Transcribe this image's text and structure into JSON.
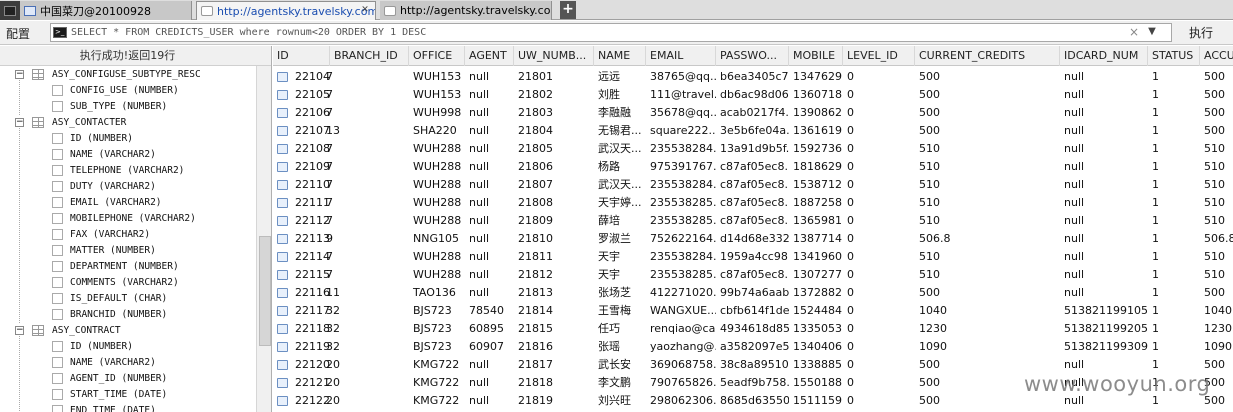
{
  "tabs": [
    {
      "label": "",
      "icon": "terminal-icon"
    },
    {
      "label": "中国菜刀@20100928",
      "icon": "window-icon"
    },
    {
      "label": "http://agentsky.travelsky.com...",
      "icon": "page-icon",
      "active": true
    },
    {
      "label": "http://agentsky.travelsky.com...",
      "icon": "page-icon"
    }
  ],
  "tab_new_label": "+",
  "toolbar": {
    "config_label": "配置",
    "sql": "SELECT * FROM CREDICTS_USER where rownum<20 ORDER BY 1 DESC",
    "clear_glyph": "×",
    "dropdown_glyph": "▼",
    "execute_label": "执行"
  },
  "left_panel": {
    "status": "执行成功!返回19行",
    "tree": [
      {
        "kind": "table",
        "toggle": "−",
        "label": "ASY_CONFIGUSE_SUBTYPE_RESC"
      },
      {
        "kind": "column",
        "label": "CONFIG_USE (NUMBER)"
      },
      {
        "kind": "column",
        "label": "SUB_TYPE (NUMBER)"
      },
      {
        "kind": "table",
        "toggle": "−",
        "label": "ASY_CONTACTER"
      },
      {
        "kind": "column",
        "label": "ID (NUMBER)"
      },
      {
        "kind": "column",
        "label": "NAME (VARCHAR2)"
      },
      {
        "kind": "column",
        "label": "TELEPHONE (VARCHAR2)"
      },
      {
        "kind": "column",
        "label": "DUTY (VARCHAR2)"
      },
      {
        "kind": "column",
        "label": "EMAIL (VARCHAR2)"
      },
      {
        "kind": "column",
        "label": "MOBILEPHONE (VARCHAR2)"
      },
      {
        "kind": "column",
        "label": "FAX (VARCHAR2)"
      },
      {
        "kind": "column",
        "label": "MATTER (NUMBER)"
      },
      {
        "kind": "column",
        "label": "DEPARTMENT (NUMBER)"
      },
      {
        "kind": "column",
        "label": "COMMENTS (VARCHAR2)"
      },
      {
        "kind": "column",
        "label": "IS_DEFAULT (CHAR)"
      },
      {
        "kind": "column",
        "label": "BRANCHID (NUMBER)"
      },
      {
        "kind": "table",
        "toggle": "−",
        "label": "ASY_CONTRACT"
      },
      {
        "kind": "column",
        "label": "ID (NUMBER)"
      },
      {
        "kind": "column",
        "label": "NAME (VARCHAR2)"
      },
      {
        "kind": "column",
        "label": "AGENT_ID (NUMBER)"
      },
      {
        "kind": "column",
        "label": "START_TIME (DATE)"
      },
      {
        "kind": "column",
        "label": "END_TIME (DATE)"
      }
    ]
  },
  "grid": {
    "columns": [
      "ID",
      "BRANCH_ID",
      "OFFICE",
      "AGENT",
      "UW_NUMB...",
      "NAME",
      "EMAIL",
      "PASSWO...",
      "MOBILE",
      "LEVEL_ID",
      "CURRENT_CREDITS",
      "IDCARD_NUM",
      "STATUS",
      "ACCU"
    ],
    "rows": [
      [
        "22104",
        "7",
        "WUH153",
        "null",
        "21801",
        "远远",
        "38765@qq....",
        "b6ea3405c7...",
        "1347629...",
        "0",
        "500",
        "null",
        "1",
        "500"
      ],
      [
        "22105",
        "7",
        "WUH153",
        "null",
        "21802",
        "刘胜",
        "111@travel...",
        "db6ac98d06...",
        "1360718...",
        "0",
        "500",
        "null",
        "1",
        "500"
      ],
      [
        "22106",
        "7",
        "WUH998",
        "null",
        "21803",
        "李融融",
        "35678@qq....",
        "acab0217f4...",
        "1390862...",
        "0",
        "500",
        "null",
        "1",
        "500"
      ],
      [
        "22107",
        "13",
        "SHA220",
        "null",
        "21804",
        "无锡君...",
        "square222...",
        "3e5b6fe04a...",
        "1361619...",
        "0",
        "500",
        "null",
        "1",
        "500"
      ],
      [
        "22108",
        "7",
        "WUH288",
        "null",
        "21805",
        "武汉天...",
        "235538284...",
        "13a91d9b5f...",
        "1592736...",
        "0",
        "510",
        "null",
        "1",
        "510"
      ],
      [
        "22109",
        "7",
        "WUH288",
        "null",
        "21806",
        "杨路",
        "975391767...",
        "c87af05ec8...",
        "1818629...",
        "0",
        "510",
        "null",
        "1",
        "510"
      ],
      [
        "22110",
        "7",
        "WUH288",
        "null",
        "21807",
        "武汉天...",
        "235538284...",
        "c87af05ec8...",
        "1538712...",
        "0",
        "510",
        "null",
        "1",
        "510"
      ],
      [
        "22111",
        "7",
        "WUH288",
        "null",
        "21808",
        "天宇婷...",
        "235538285...",
        "c87af05ec8...",
        "1887258...",
        "0",
        "510",
        "null",
        "1",
        "510"
      ],
      [
        "22112",
        "7",
        "WUH288",
        "null",
        "21809",
        "薛培",
        "235538285...",
        "c87af05ec8...",
        "1365981...",
        "0",
        "510",
        "null",
        "1",
        "510"
      ],
      [
        "22113",
        "9",
        "NNG105",
        "null",
        "21810",
        "罗淑兰",
        "752622164...",
        "d14d68e332...",
        "1387714...",
        "0",
        "506.8",
        "null",
        "1",
        "506.8"
      ],
      [
        "22114",
        "7",
        "WUH288",
        "null",
        "21811",
        "天宇",
        "235538284...",
        "1959a4cc98...",
        "1341960...",
        "0",
        "510",
        "null",
        "1",
        "510"
      ],
      [
        "22115",
        "7",
        "WUH288",
        "null",
        "21812",
        "天宇",
        "235538285...",
        "c87af05ec8...",
        "1307277...",
        "0",
        "510",
        "null",
        "1",
        "510"
      ],
      [
        "22116",
        "11",
        "TAO136",
        "null",
        "21813",
        "张场芝",
        "412271020...",
        "99b74a6aab...",
        "1372882...",
        "0",
        "500",
        "null",
        "1",
        "500"
      ],
      [
        "22117",
        "32",
        "BJS723",
        "78540",
        "21814",
        "王雪梅",
        "WANGXUE...",
        "cbfb614f1de...",
        "1524484...",
        "0",
        "1040",
        "5138211991050...",
        "1",
        "1040"
      ],
      [
        "22118",
        "32",
        "BJS723",
        "60895",
        "21815",
        "任巧",
        "renqiao@ca...",
        "4934618d85...",
        "1335053...",
        "0",
        "1230",
        "5138211992050...",
        "1",
        "1230"
      ],
      [
        "22119",
        "32",
        "BJS723",
        "60907",
        "21816",
        "张瑶",
        "yaozhang@...",
        "a3582097e5...",
        "1340406...",
        "0",
        "1090",
        "5138211993092...",
        "1",
        "1090"
      ],
      [
        "22120",
        "20",
        "KMG722",
        "null",
        "21817",
        "武长安",
        "369068758...",
        "38c8a89510...",
        "1338885...",
        "0",
        "500",
        "null",
        "1",
        "500"
      ],
      [
        "22121",
        "20",
        "KMG722",
        "null",
        "21818",
        "李文鹏",
        "790765826...",
        "5eadf9b758...",
        "1550188...",
        "0",
        "500",
        "null",
        "1",
        "500"
      ],
      [
        "22122",
        "20",
        "KMG722",
        "null",
        "21819",
        "刘兴旺",
        "298062306...",
        "8685d63550...",
        "1511159...",
        "0",
        "500",
        "null",
        "1",
        "500"
      ]
    ]
  },
  "watermark": "www.wooyun.org"
}
